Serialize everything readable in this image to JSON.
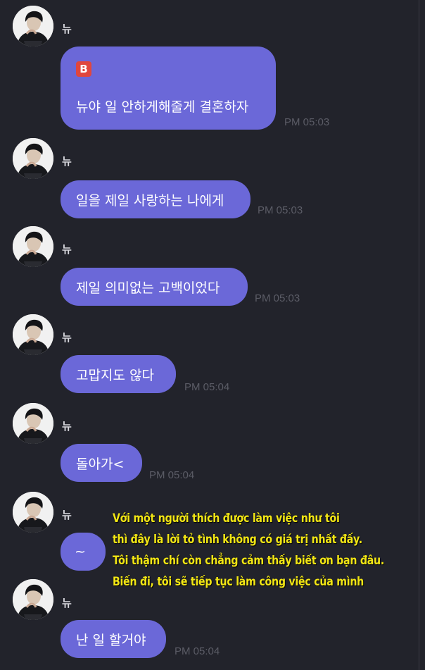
{
  "sender_name": "뉴",
  "messages": [
    {
      "text": "뉴야 일 안하게해줄게 결혼하자",
      "time": "PM 05:03",
      "badge": "B"
    },
    {
      "text": "일을 제일 사랑하는 나에게",
      "time": "PM 05:03"
    },
    {
      "text": "제일 의미없는 고백이었다",
      "time": "PM 05:03"
    },
    {
      "text": "고맙지도 않다",
      "time": "PM 05:04"
    },
    {
      "text": "돌아가<",
      "time": "PM 05:04"
    },
    {
      "text": "~",
      "time": ""
    },
    {
      "text": "난 일 할거야",
      "time": "PM 05:04"
    }
  ],
  "subtitle": [
    "Với một người thích được làm việc như tôi",
    "thì đây là lời tỏ tình không có giá trị nhất đấy.",
    "Tôi thậm chí còn chẳng cảm thấy biết ơn bạn đâu.",
    "Biến đi, tôi sẽ tiếp tục làm công việc của mình"
  ],
  "colors": {
    "background": "#22232b",
    "bubble": "#6b68d8",
    "timestamp": "#5b5c66",
    "subtitle": "#f2e614",
    "badge": "#e0463e"
  }
}
